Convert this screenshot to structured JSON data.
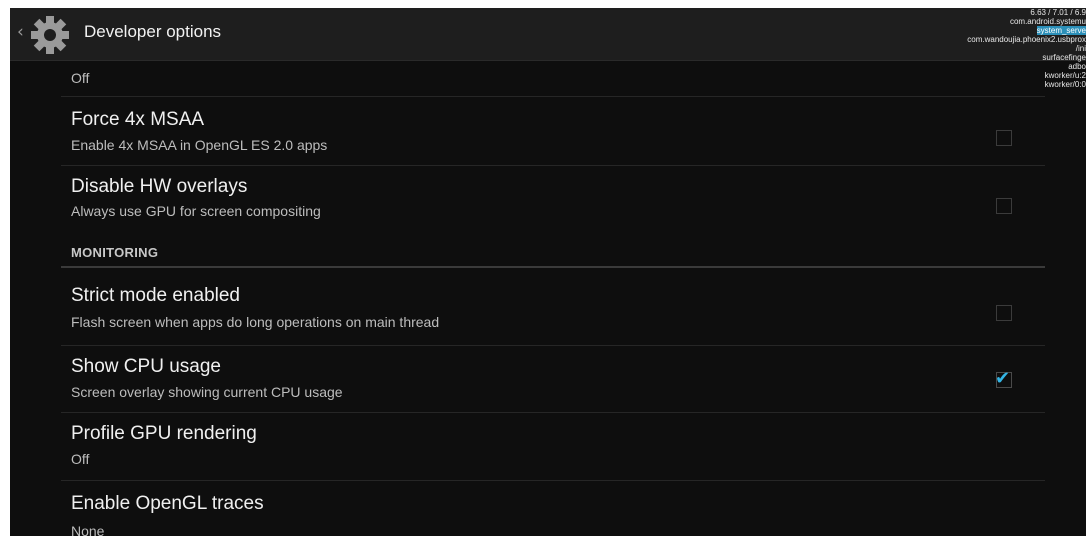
{
  "action_bar": {
    "title": "Developer options",
    "back_icon": "chevron-left-icon",
    "app_icon": "gear-icon"
  },
  "cpu_overlay": {
    "lines": [
      "6.63 / 7.01 / 6.9",
      "com.android.systemu",
      "system_serve",
      "com.wandoujia.phoenix2.usbprox",
      "/ini",
      "surfacefinge",
      "adbo",
      "kworker/u:2",
      "kworker/0:0"
    ]
  },
  "partial_item": {
    "summary": "Off"
  },
  "items": [
    {
      "title": "Force 4x MSAA",
      "summary": "Enable 4x MSAA in OpenGL ES 2.0 apps",
      "checked": false
    },
    {
      "title": "Disable HW overlays",
      "summary": "Always use GPU for screen compositing",
      "checked": false
    }
  ],
  "section": {
    "header": "MONITORING"
  },
  "monitoring_items": [
    {
      "title": "Strict mode enabled",
      "summary": "Flash screen when apps do long operations on main thread",
      "checked": false
    },
    {
      "title": "Show CPU usage",
      "summary": "Screen overlay showing current CPU usage",
      "checked": true
    },
    {
      "title": "Profile GPU rendering",
      "summary": "Off"
    },
    {
      "title": "Enable OpenGL traces",
      "summary": "None"
    }
  ],
  "colors": {
    "accent": "#33b5e5",
    "background": "#0e0e0e"
  }
}
